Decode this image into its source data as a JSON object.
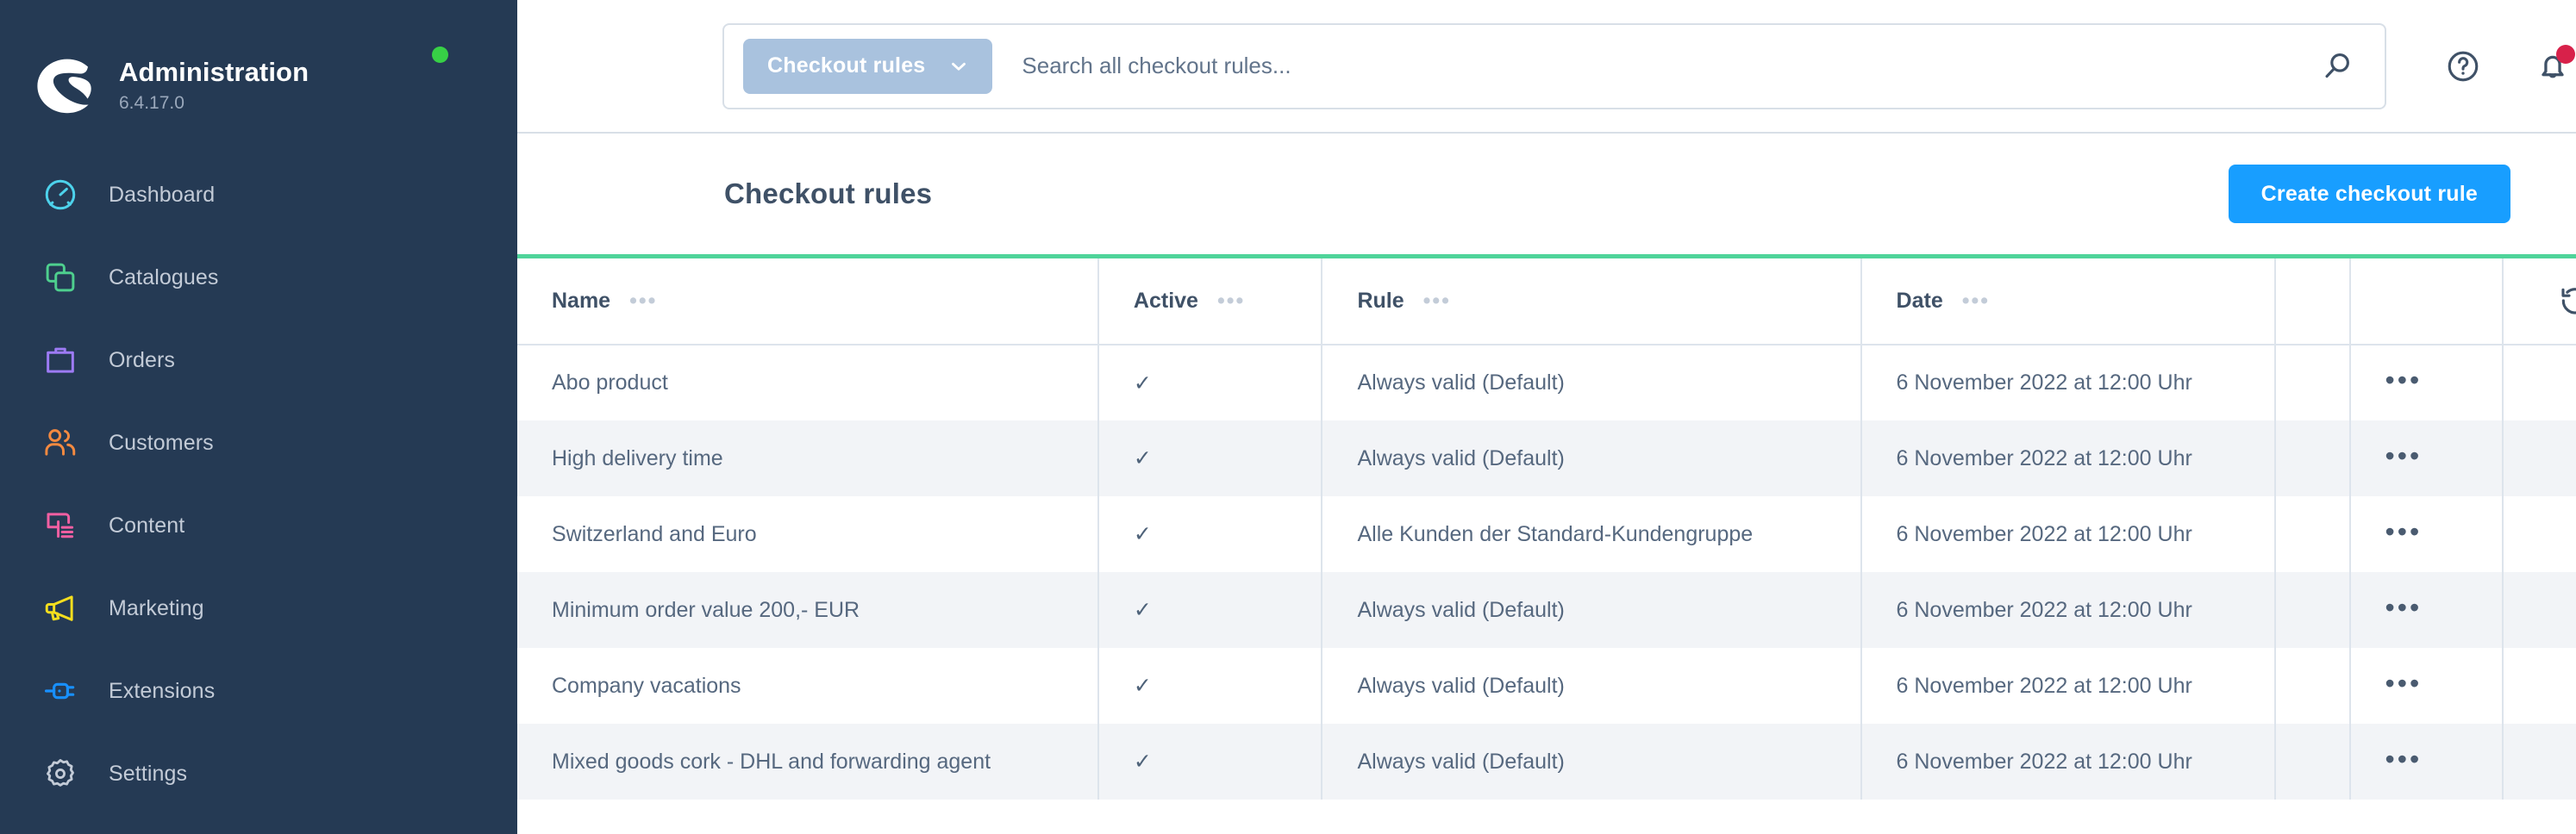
{
  "sidebar": {
    "brand": {
      "title": "Administration",
      "version": "6.4.17.0",
      "status_color": "#37d046",
      "logo_icon": "shopware-logo-icon"
    },
    "items": [
      {
        "label": "Dashboard",
        "icon": "dashboard-gauge-icon",
        "color": "#4dd2ec"
      },
      {
        "label": "Catalogues",
        "icon": "catalogues-stack-icon",
        "color": "#4ecf8e"
      },
      {
        "label": "Orders",
        "icon": "orders-bag-icon",
        "color": "#9d7bf5"
      },
      {
        "label": "Customers",
        "icon": "customers-people-icon",
        "color": "#f58a40"
      },
      {
        "label": "Content",
        "icon": "content-pages-icon",
        "color": "#f25fa2"
      },
      {
        "label": "Marketing",
        "icon": "marketing-megaphone-icon",
        "color": "#f5de1e"
      },
      {
        "label": "Extensions",
        "icon": "extensions-plug-icon",
        "color": "#1890ff"
      },
      {
        "label": "Settings",
        "icon": "settings-gear-icon",
        "color": "#c3cbd7"
      }
    ]
  },
  "topbar": {
    "scope_label": "Checkout rules",
    "scope_chevron_icon": "chevron-down-icon",
    "search_placeholder": "Search all checkout rules...",
    "search_value": "",
    "search_icon": "search-icon",
    "help_icon": "question-circle-icon",
    "notification_icon": "bell-icon",
    "notification_badge_color": "#d8214a"
  },
  "page": {
    "title": "Checkout rules",
    "create_button": "Create checkout rule",
    "accent_color": "#189eff",
    "grid_top_border_color": "#4fd49a",
    "refresh_icon": "refresh-undo-icon"
  },
  "table": {
    "columns": [
      {
        "label": "Name",
        "menu": "•••"
      },
      {
        "label": "Active",
        "menu": "•••"
      },
      {
        "label": "Rule",
        "menu": "•••"
      },
      {
        "label": "Date",
        "menu": "•••"
      }
    ],
    "row_action_menu": "•••",
    "active_check": "✓",
    "rows": [
      {
        "name": "Abo product",
        "active": "✓",
        "rule": "Always valid (Default)",
        "date": "6 November 2022 at 12:00 Uhr"
      },
      {
        "name": "High delivery time",
        "active": "✓",
        "rule": "Always valid (Default)",
        "date": "6 November 2022 at 12:00 Uhr"
      },
      {
        "name": "Switzerland and Euro",
        "active": "✓",
        "rule": "Alle Kunden der Standard-Kundengruppe",
        "date": "6 November 2022 at 12:00 Uhr"
      },
      {
        "name": "Minimum order value 200,- EUR",
        "active": "✓",
        "rule": "Always valid (Default)",
        "date": "6 November 2022 at 12:00 Uhr"
      },
      {
        "name": "Company vacations",
        "active": "✓",
        "rule": "Always valid (Default)",
        "date": "6 November 2022 at 12:00 Uhr"
      },
      {
        "name": "Mixed goods cork - DHL and forwarding agent",
        "active": "✓",
        "rule": "Always valid (Default)",
        "date": "6 November 2022 at 12:00 Uhr"
      }
    ]
  }
}
